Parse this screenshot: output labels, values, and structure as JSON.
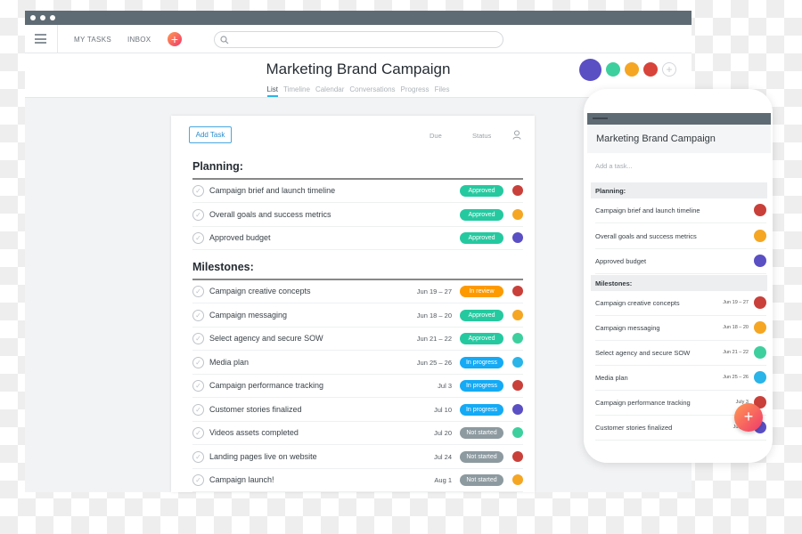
{
  "window": {
    "toolbar": {
      "my_tasks": "MY TASKS",
      "inbox": "INBOX",
      "add_icon": "+",
      "search_placeholder": ""
    }
  },
  "project": {
    "title": "Marketing Brand Campaign",
    "tabs": [
      "List",
      "Timeline",
      "Calendar",
      "Conversations",
      "Progress",
      "Files"
    ],
    "active_tab": "List",
    "members": [
      "#5b4fc4",
      "#3ecf9e",
      "#f5a623",
      "#d8433a"
    ]
  },
  "list": {
    "add_task": "Add Task",
    "col_due": "Due",
    "col_status": "Status",
    "sections": [
      {
        "title": "Planning:",
        "tasks": [
          {
            "name": "Campaign brief and launch timeline",
            "due": "",
            "status": "Approved",
            "status_color": "#25c9a0",
            "avatar": "#c9403a"
          },
          {
            "name": "Overall goals and success metrics",
            "due": "",
            "status": "Approved",
            "status_color": "#25c9a0",
            "avatar": "#f5a623"
          },
          {
            "name": "Approved budget",
            "due": "",
            "status": "Approved",
            "status_color": "#25c9a0",
            "avatar": "#5b4fc4"
          }
        ]
      },
      {
        "title": "Milestones:",
        "tasks": [
          {
            "name": "Campaign creative concepts",
            "due": "Jun 19 – 27",
            "status": "In review",
            "status_color": "#fd9a00",
            "avatar": "#c9403a"
          },
          {
            "name": "Campaign messaging",
            "due": "Jun 18 – 20",
            "status": "Approved",
            "status_color": "#25c9a0",
            "avatar": "#f5a623"
          },
          {
            "name": "Select agency and secure SOW",
            "due": "Jun 21 – 22",
            "status": "Approved",
            "status_color": "#25c9a0",
            "avatar": "#3ecf9e"
          },
          {
            "name": "Media plan",
            "due": "Jun 25 – 26",
            "status": "In progress",
            "status_color": "#14aaf5",
            "avatar": "#2ab4e8"
          },
          {
            "name": "Campaign performance tracking",
            "due": "Jul 3",
            "status": "In progress",
            "status_color": "#14aaf5",
            "avatar": "#c9403a"
          },
          {
            "name": "Customer stories finalized",
            "due": "Jul 10",
            "status": "In progress",
            "status_color": "#14aaf5",
            "avatar": "#5b4fc4"
          },
          {
            "name": "Videos assets completed",
            "due": "Jul 20",
            "status": "Not started",
            "status_color": "#8d9aa0",
            "avatar": "#3ecf9e"
          },
          {
            "name": "Landing pages live on website",
            "due": "Jul 24",
            "status": "Not started",
            "status_color": "#8d9aa0",
            "avatar": "#c9403a"
          },
          {
            "name": "Campaign launch!",
            "due": "Aug 1",
            "status": "Not started",
            "status_color": "#8d9aa0",
            "avatar": "#f5a623"
          }
        ]
      }
    ]
  },
  "mobile": {
    "title": "Marketing Brand Campaign",
    "add_placeholder": "Add a task...",
    "sections": [
      {
        "title": "Planning:",
        "tasks": [
          {
            "name": "Campaign brief and launch timeline",
            "due": "",
            "avatar": "#c9403a"
          },
          {
            "name": "Overall goals and success metrics",
            "due": "",
            "avatar": "#f5a623"
          },
          {
            "name": "Approved budget",
            "due": "",
            "avatar": "#5b4fc4"
          }
        ]
      },
      {
        "title": "Milestones:",
        "tasks": [
          {
            "name": "Campaign creative concepts",
            "due": "Jun 19 – 27",
            "avatar": "#c9403a"
          },
          {
            "name": "Campaign messaging",
            "due": "Jun 18 – 20",
            "avatar": "#f5a623"
          },
          {
            "name": "Select agency and secure SOW",
            "due": "Jun 21 – 22",
            "avatar": "#3ecf9e"
          },
          {
            "name": "Media plan",
            "due": "Jun 25 – 26",
            "avatar": "#2ab4e8"
          },
          {
            "name": "Campaign performance tracking",
            "due": "July 3",
            "avatar": "#c9403a"
          },
          {
            "name": "Customer stories finalized",
            "due": "July 10",
            "avatar": "#5b4fc4"
          }
        ]
      }
    ],
    "fab": "+"
  }
}
